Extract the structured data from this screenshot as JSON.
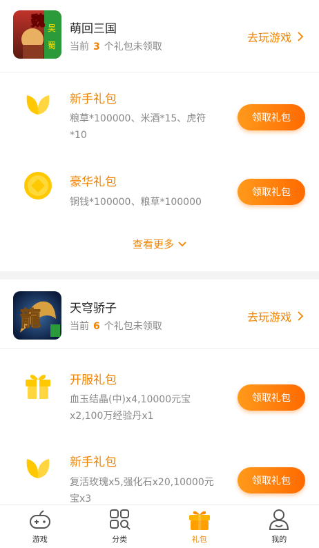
{
  "games": [
    {
      "name": "萌回三国",
      "sub_prefix": "当前",
      "count": "3",
      "sub_suffix": "个礼包未领取",
      "play_label": "去玩游戏",
      "gifts": [
        {
          "title": "新手礼包",
          "desc": "粮草*100000、米酒*15、虎符*10",
          "button": "领取礼包",
          "icon": "leaf-icon"
        },
        {
          "title": "豪华礼包",
          "desc": "铜钱*100000、粮草*100000",
          "button": "领取礼包",
          "icon": "coin-icon"
        }
      ],
      "more_label": "查看更多"
    },
    {
      "name": "天穹骄子",
      "sub_prefix": "当前",
      "count": "6",
      "sub_suffix": "个礼包未领取",
      "play_label": "去玩游戏",
      "gifts": [
        {
          "title": "开服礼包",
          "desc": "血玉结晶(中)x4,10000元宝x2,100万经验丹x1",
          "button": "领取礼包",
          "icon": "gift-box-icon"
        },
        {
          "title": "新手礼包",
          "desc": "复活玫瑰x5,强化石x20,10000元宝x3",
          "button": "领取礼包",
          "icon": "leaf-icon"
        }
      ]
    }
  ],
  "tabbar": {
    "items": [
      {
        "label": "游戏",
        "icon": "gamepad-icon"
      },
      {
        "label": "分类",
        "icon": "category-icon"
      },
      {
        "label": "礼包",
        "icon": "gift-icon"
      },
      {
        "label": "我的",
        "icon": "user-icon"
      }
    ],
    "active": "礼包"
  },
  "colors": {
    "accent": "#f08400",
    "button_start": "#ff9a1c",
    "button_end": "#ff6a00",
    "icon_yellow": "#ffc800"
  }
}
